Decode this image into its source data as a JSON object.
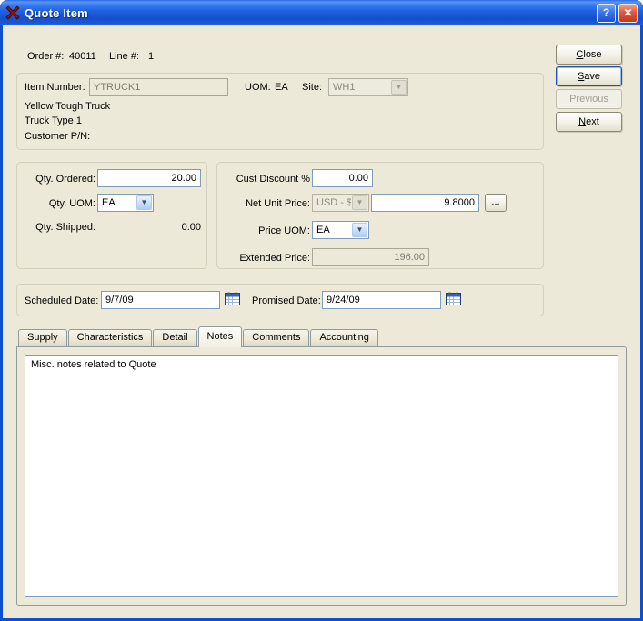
{
  "titlebar": {
    "title": "Quote Item",
    "help_label": "?",
    "close_label": "✕"
  },
  "header": {
    "order_label": "Order #:",
    "order_value": "40011",
    "line_label": "Line #:",
    "line_value": "1"
  },
  "nav_buttons": {
    "close": {
      "mnemonic": "C",
      "rest": "lose"
    },
    "save": {
      "mnemonic": "S",
      "rest": "ave"
    },
    "previous": {
      "label": "Previous"
    },
    "next": {
      "mnemonic": "N",
      "rest": "ext"
    }
  },
  "item": {
    "number_label": "Item Number:",
    "number_value": "YTRUCK1",
    "uom_label": "UOM:",
    "uom_value": "EA",
    "site_label": "Site:",
    "site_value": "WH1",
    "description_line1": "Yellow Tough Truck",
    "description_line2": "Truck Type 1",
    "customer_pn_label": "Customer P/N:",
    "customer_pn_value": ""
  },
  "quantity": {
    "ordered_label": "Qty. Ordered:",
    "ordered_value": "20.00",
    "uom_label": "Qty. UOM:",
    "uom_value": "EA",
    "shipped_label": "Qty. Shipped:",
    "shipped_value": "0.00"
  },
  "pricing": {
    "discount_label": "Cust Discount %",
    "discount_value": "0.00",
    "net_unit_label": "Net Unit Price:",
    "currency_value": "USD - $",
    "net_unit_value": "9.8000",
    "lookup_label": "...",
    "price_uom_label": "Price UOM:",
    "price_uom_value": "EA",
    "extended_label": "Extended Price:",
    "extended_value": "196.00"
  },
  "dates": {
    "scheduled_label": "Scheduled Date:",
    "scheduled_value": "9/7/09",
    "promised_label": "Promised Date:",
    "promised_value": "9/24/09"
  },
  "tabs": [
    {
      "label": "Supply",
      "active": false
    },
    {
      "label": "Characteristics",
      "active": false
    },
    {
      "label": "Detail",
      "active": false
    },
    {
      "label": "Notes",
      "active": true
    },
    {
      "label": "Comments",
      "active": false
    },
    {
      "label": "Accounting",
      "active": false
    }
  ],
  "notes": {
    "text": "Misc. notes related to Quote"
  },
  "icons": {
    "dropdown_arrow": "▼"
  },
  "colors": {
    "titlebar_blue": "#1C5AD6",
    "dialog_bg": "#ECE9D8",
    "field_border": "#7F9DB9",
    "close_red": "#D6492A"
  }
}
